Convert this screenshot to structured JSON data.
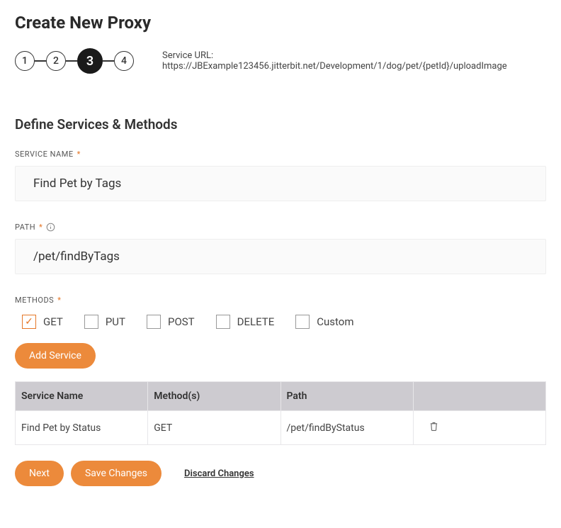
{
  "page_title": "Create New Proxy",
  "stepper": {
    "steps": [
      "1",
      "2",
      "3",
      "4"
    ],
    "active_index": 2
  },
  "service_url_label": "Service URL: ",
  "service_url_value": "https://JBExample123456.jitterbit.net/Development/1/dog/pet/{petId}/uploadImage",
  "section_title": "Define Services & Methods",
  "fields": {
    "service_name": {
      "label": "SERVICE NAME",
      "value": "Find Pet by Tags"
    },
    "path": {
      "label": "PATH",
      "value": "/pet/findByTags"
    },
    "methods": {
      "label": "METHODS",
      "options": [
        {
          "label": "GET",
          "checked": true
        },
        {
          "label": "PUT",
          "checked": false
        },
        {
          "label": "POST",
          "checked": false
        },
        {
          "label": "DELETE",
          "checked": false
        },
        {
          "label": "Custom",
          "checked": false
        }
      ]
    }
  },
  "buttons": {
    "add_service": "Add Service",
    "next": "Next",
    "save_changes": "Save Changes",
    "discard_changes": "Discard Changes"
  },
  "table": {
    "headers": [
      "Service Name",
      "Method(s)",
      "Path",
      ""
    ],
    "rows": [
      {
        "name": "Find Pet by Status",
        "methods": "GET",
        "path": "/pet/findByStatus"
      }
    ]
  }
}
